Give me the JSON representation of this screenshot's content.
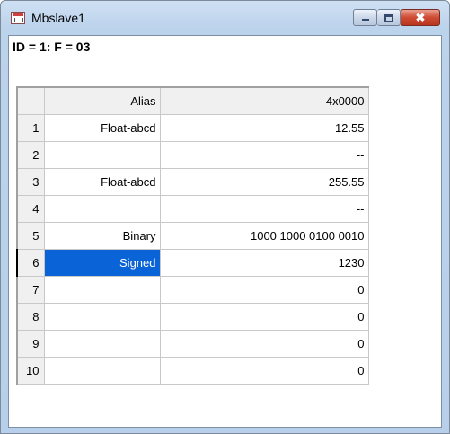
{
  "window": {
    "title": "Mbslave1",
    "controls": {
      "minimize": "–",
      "maximize": "□",
      "close": "✖"
    }
  },
  "status_line": "ID = 1: F = 03",
  "table": {
    "headers": [
      "",
      "Alias",
      "4x0000"
    ],
    "rows": [
      {
        "num": "1",
        "alias": "Float-abcd",
        "value": "12.55"
      },
      {
        "num": "2",
        "alias": "",
        "value": "--"
      },
      {
        "num": "3",
        "alias": "Float-abcd",
        "value": "255.55"
      },
      {
        "num": "4",
        "alias": "",
        "value": "--"
      },
      {
        "num": "5",
        "alias": "Binary",
        "value": "1000 1000 0100 0010"
      },
      {
        "num": "6",
        "alias": "Signed",
        "value": "1230"
      },
      {
        "num": "7",
        "alias": "",
        "value": "0"
      },
      {
        "num": "8",
        "alias": "",
        "value": "0"
      },
      {
        "num": "9",
        "alias": "",
        "value": "0"
      },
      {
        "num": "10",
        "alias": "",
        "value": "0"
      }
    ],
    "selected_row": "6"
  }
}
